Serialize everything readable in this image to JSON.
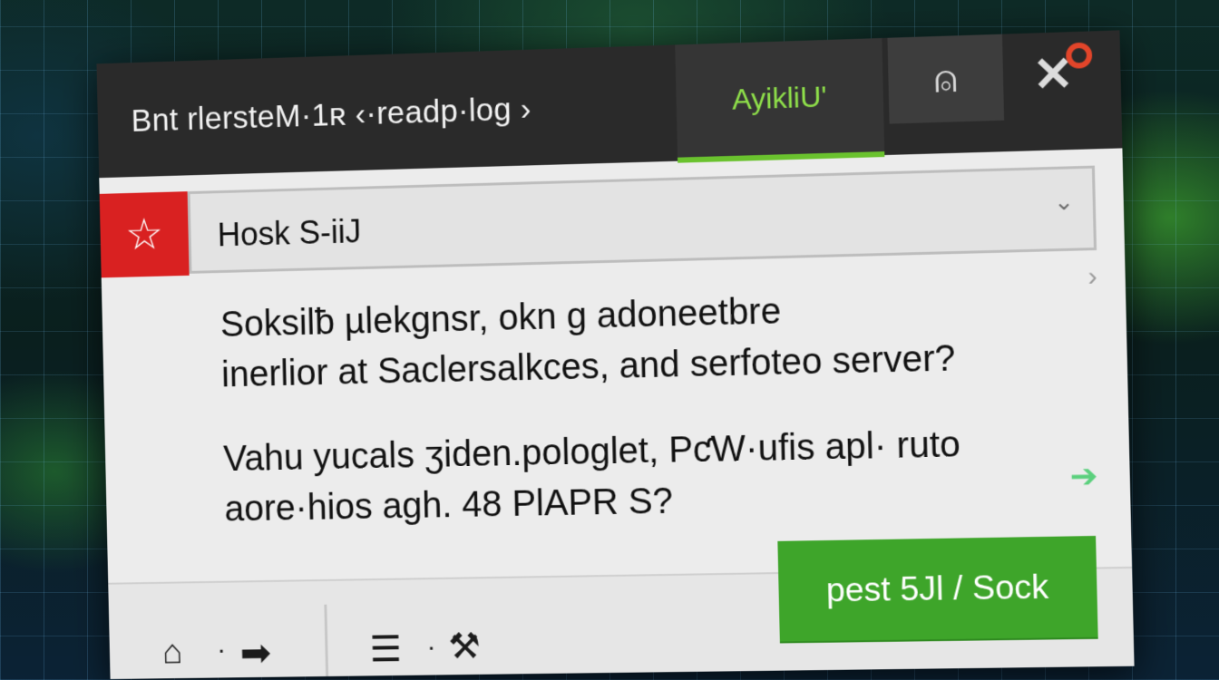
{
  "window": {
    "title": "Bnt rlersteM·1ʀ ‹·readp·log ›",
    "active_tab": "AyikliU'",
    "tab_icon": "house-a-icon",
    "close_icon": "close-icon"
  },
  "search": {
    "value": "Hosk S-iiJ",
    "star_icon": "star-icon",
    "dropdown_icon": "chevron-down-icon"
  },
  "content": {
    "line1": "Soksilƀ µlekgnsr, okn g adoneetbre",
    "line2": "inerlior at Saclersalkces, and serfoteo server?",
    "line3": "Vahu yucals ӡiden.pologlet, PƈW·ufis apl· ruto",
    "line4": "aore·hios agh. 48 PlAPR S?"
  },
  "footer": {
    "home_icon": "home-icon",
    "forward_icon": "forward-arrow-icon",
    "doc_icon": "document-icon",
    "tool_icon": "tool-icon",
    "cta_label": "pest 5Jl / Sock"
  },
  "colors": {
    "accent_green": "#6ac22e",
    "cta_green": "#3ea52a",
    "star_red": "#d92121",
    "close_dot": "#e2452a"
  }
}
